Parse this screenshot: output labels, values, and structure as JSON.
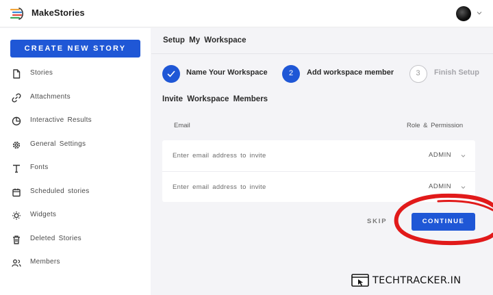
{
  "app": {
    "brand": "MakeStories"
  },
  "colors": {
    "accent": "#1f57d6",
    "annotation": "#e11a1a"
  },
  "sidebar": {
    "create_label": "CREATE NEW STORY",
    "items": [
      {
        "label": "Stories",
        "icon": "document-icon"
      },
      {
        "label": "Attachments",
        "icon": "link-icon"
      },
      {
        "label": "Interactive Results",
        "icon": "pie-chart-icon"
      },
      {
        "label": "General Settings",
        "icon": "gear-icon"
      },
      {
        "label": "Fonts",
        "icon": "font-icon"
      },
      {
        "label": "Scheduled stories",
        "icon": "calendar-icon"
      },
      {
        "label": "Widgets",
        "icon": "widget-icon"
      },
      {
        "label": "Deleted Stories",
        "icon": "trash-icon"
      },
      {
        "label": "Members",
        "icon": "users-icon"
      }
    ]
  },
  "main": {
    "title": "Setup My Workspace",
    "steps": [
      {
        "label": "Name Your Workspace",
        "state": "done",
        "marker": "check-icon"
      },
      {
        "label": "Add workspace member",
        "state": "active",
        "number": "2"
      },
      {
        "label": "Finish Setup",
        "state": "pending",
        "number": "3"
      }
    ],
    "invite": {
      "title": "Invite Workspace Members",
      "col_email": "Email",
      "col_role": "Role & Permission",
      "rows": [
        {
          "placeholder": "Enter email address to invite",
          "role": "ADMIN"
        },
        {
          "placeholder": "Enter email address to invite",
          "role": "ADMIN"
        }
      ]
    },
    "skip_label": "SKIP",
    "continue_label": "CONTINUE"
  },
  "watermark": {
    "text": "TECHTRACKER.IN"
  }
}
